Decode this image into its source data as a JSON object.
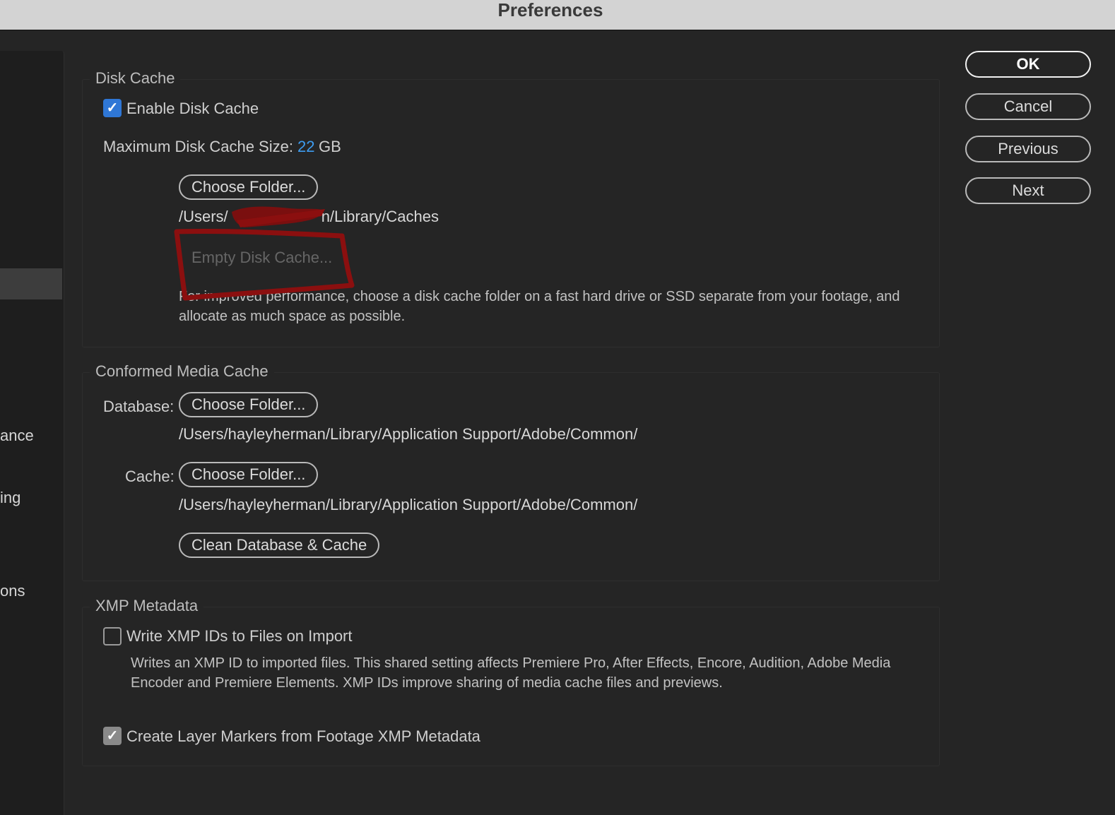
{
  "window": {
    "title": "Preferences"
  },
  "sidebar": {
    "items": [
      "ance",
      "ing",
      "ons"
    ]
  },
  "disk_cache": {
    "section_title": "Disk Cache",
    "enable_label": "Enable Disk Cache",
    "enable_checked": true,
    "max_size_label": "Maximum Disk Cache Size:",
    "max_size_value": "22",
    "max_size_unit": "GB",
    "choose_folder_label": "Choose Folder...",
    "path_prefix": "/Users/",
    "path_suffix": "n/Library/Caches",
    "empty_cache_label": "Empty Disk Cache...",
    "hint_line1": "For improved performance, choose a disk cache folder on a fast hard drive or SSD separate from your footage, and",
    "hint_line2": "allocate as much space as possible."
  },
  "conformed_media_cache": {
    "section_title": "Conformed Media Cache",
    "database_label": "Database:",
    "database_button": "Choose Folder...",
    "database_path": "/Users/hayleyherman/Library/Application Support/Adobe/Common/",
    "cache_label": "Cache:",
    "cache_button": "Choose Folder...",
    "cache_path": "/Users/hayleyherman/Library/Application Support/Adobe/Common/",
    "clean_button": "Clean Database & Cache"
  },
  "xmp_metadata": {
    "section_title": "XMP Metadata",
    "write_ids_label": "Write XMP IDs to Files on Import",
    "write_ids_checked": false,
    "write_ids_desc_line1": "Writes an XMP ID to imported files. This shared setting affects Premiere Pro, After Effects, Encore, Audition, Adobe Media",
    "write_ids_desc_line2": "Encoder and Premiere Elements. XMP IDs improve sharing of media cache files and previews.",
    "layer_markers_label": "Create Layer Markers from Footage XMP Metadata",
    "layer_markers_checked": true
  },
  "actions": {
    "ok": "OK",
    "cancel": "Cancel",
    "previous": "Previous",
    "next": "Next"
  },
  "check_glyph": "✓",
  "colors": {
    "accent": "#2f77d6",
    "value_blue": "#3d9cf0",
    "annotation_red": "#8b0f0f"
  }
}
